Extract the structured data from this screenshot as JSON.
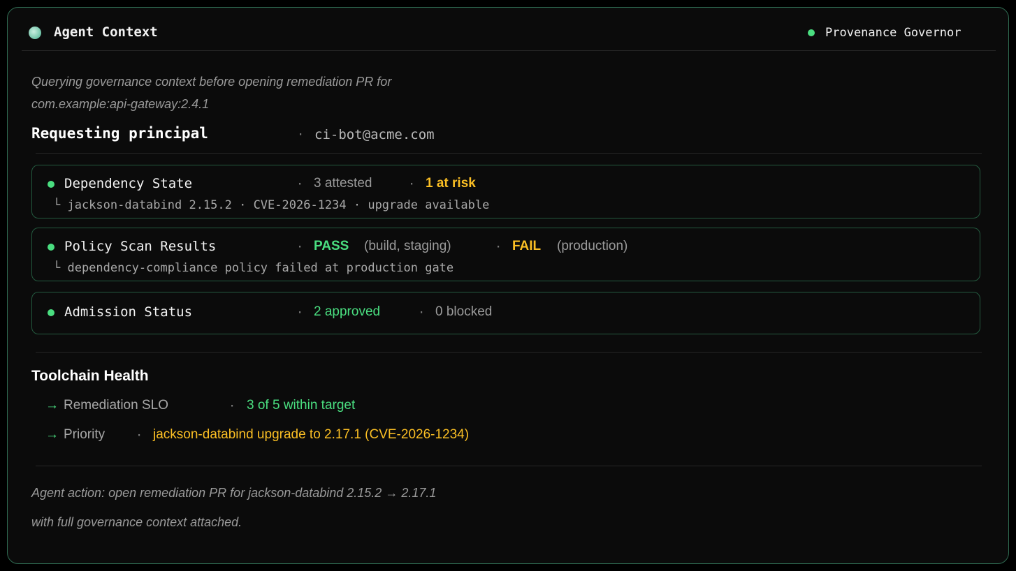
{
  "header": {
    "title": "Agent Context",
    "governor_label": "Provenance Governor"
  },
  "intro": {
    "line1": "Querying governance context before opening remediation PR for",
    "line2": "com.example:api-gateway:2.4.1"
  },
  "principal": {
    "label": "Requesting principal",
    "value": "ci-bot@acme.com"
  },
  "separator": "·",
  "cards": {
    "dependency": {
      "title": "Dependency State",
      "stat1": "3 attested",
      "stat2": "1 at risk",
      "detail": "└ jackson-databind 2.15.2 · CVE-2026-1234 · upgrade available"
    },
    "policy": {
      "title": "Policy Scan Results",
      "pass_label": "PASS",
      "pass_scope": "(build, staging)",
      "fail_label": "FAIL",
      "fail_scope": "(production)",
      "detail": "└ dependency-compliance policy failed at production gate"
    },
    "admission": {
      "title": "Admission Status",
      "approved": "2 approved",
      "blocked": "0 blocked"
    }
  },
  "toolchain": {
    "title": "Toolchain Health",
    "arrow": "→",
    "rows": [
      {
        "label": "Remediation SLO",
        "value": "3 of 5 within target"
      },
      {
        "label": "Priority",
        "value": "jackson-databind upgrade to 2.17.1 (CVE-2026-1234)"
      }
    ]
  },
  "footer": {
    "line1": "Agent action: open remediation PR for jackson-databind 2.15.2 → 2.17.1",
    "line2": "with full governance context attached."
  },
  "colors": {
    "accent_green": "#4ade80",
    "warning_amber": "#fbbf24",
    "border_green": "#2f6b52"
  }
}
